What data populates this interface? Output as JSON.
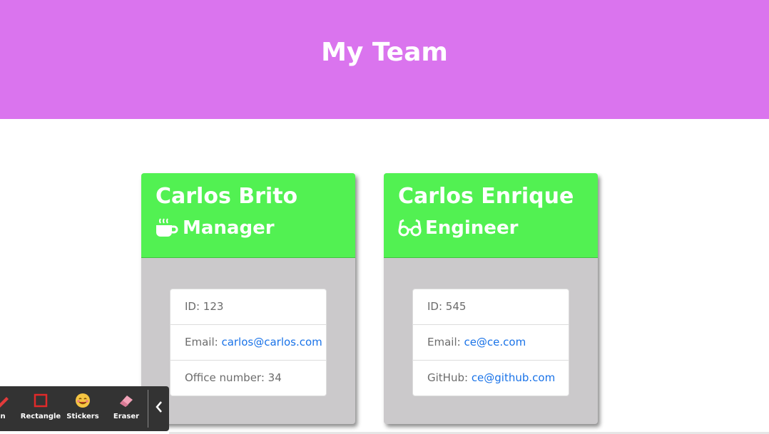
{
  "header": {
    "title": "My Team"
  },
  "cards": [
    {
      "name": "Carlos Brito",
      "role": "Manager",
      "role_icon": "coffee-icon",
      "items": [
        {
          "label": "ID: 123",
          "link": ""
        },
        {
          "label": "Email: ",
          "link": "carlos@carlos.com"
        },
        {
          "label": "Office number: 34",
          "link": ""
        }
      ]
    },
    {
      "name": "Carlos Enrique",
      "role": "Engineer",
      "role_icon": "glasses-icon",
      "items": [
        {
          "label": "ID: 545",
          "link": ""
        },
        {
          "label": "Email: ",
          "link": "ce@ce.com"
        },
        {
          "label": "GitHub: ",
          "link": "ce@github.com"
        }
      ]
    }
  ],
  "toolbar": {
    "tools": [
      {
        "label": "n",
        "icon": "pen-icon"
      },
      {
        "label": "Rectangle",
        "icon": "rectangle-icon"
      },
      {
        "label": "Stickers",
        "icon": "sticker-smile-icon"
      },
      {
        "label": "Eraser",
        "icon": "eraser-icon"
      }
    ],
    "collapse_icon": "chevron-left-icon"
  },
  "colors": {
    "header_bg": "#da74ee",
    "card_head_bg": "#52f152",
    "card_body_bg": "#cbc9cb",
    "link": "#1a73e8",
    "toolbar_bg": "#333333"
  }
}
